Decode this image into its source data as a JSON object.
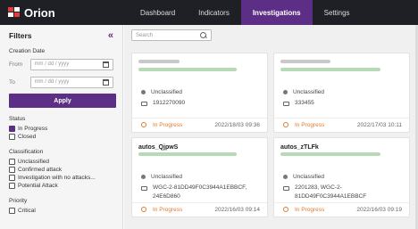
{
  "app": {
    "logo_text": "Orion"
  },
  "nav": {
    "tabs": [
      {
        "label": "Dashboard"
      },
      {
        "label": "Indicators"
      },
      {
        "label": "Investigations",
        "active": true
      },
      {
        "label": "Settings"
      }
    ]
  },
  "sidebar": {
    "title": "Filters",
    "collapse_icon": "double-chevron-left-icon",
    "creation_date": {
      "label": "Creation Date",
      "from_label": "From",
      "to_label": "To",
      "from_placeholder": "mm / dd / yyyy",
      "to_placeholder": "mm / dd / yyyy"
    },
    "apply_label": "Apply",
    "status": {
      "label": "Status",
      "options": [
        {
          "label": "In Progress",
          "checked": true
        },
        {
          "label": "Closed",
          "checked": false
        }
      ]
    },
    "classification": {
      "label": "Classification",
      "options": [
        {
          "label": "Unclassified",
          "checked": false
        },
        {
          "label": "Confirmed attack",
          "checked": false
        },
        {
          "label": "Investigation with no attacks...",
          "checked": false
        },
        {
          "label": "Potential Attack",
          "checked": false
        }
      ]
    },
    "priority": {
      "label": "Priority",
      "options": [
        {
          "label": "Critical",
          "checked": false
        }
      ]
    }
  },
  "search": {
    "placeholder": "Search"
  },
  "cards": [
    {
      "title": "",
      "classification": "Unclassified",
      "ids": "1912270090",
      "status": "In Progress",
      "date": "2022/18/03 09:36"
    },
    {
      "title": "",
      "classification": "Unclassified",
      "ids": "333455",
      "status": "In Progress",
      "date": "2022/17/03 10:11"
    },
    {
      "title": "autos_QjpwS",
      "classification": "Unclassified",
      "ids": "WGC-2-81DD49F0C3944A1EBBCF,\n24E6D860",
      "status": "In Progress",
      "date": "2022/16/03 09:14"
    },
    {
      "title": "autos_zTLFk",
      "classification": "Unclassified",
      "ids": "2201283, WGC-2-81DD49F0C3944A1EBBCF",
      "status": "In Progress",
      "date": "2022/16/03 09:19"
    }
  ],
  "colors": {
    "accent": "#5c2e86",
    "topbar": "#1f1f26",
    "status": "#e07b2e"
  }
}
